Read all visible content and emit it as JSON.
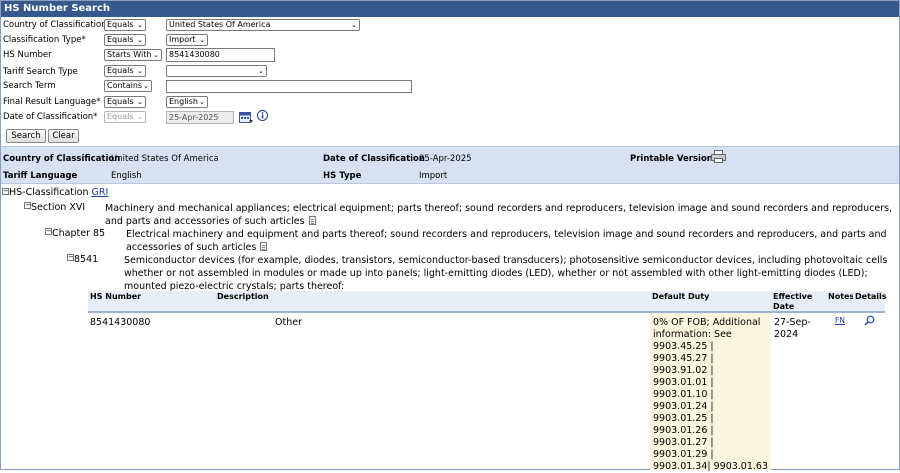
{
  "title": "HS Number Search",
  "form": {
    "country": {
      "label": "Country of Classification*",
      "op": "Equals",
      "value": "United States Of America"
    },
    "classification_type": {
      "label": "Classification Type*",
      "op": "Equals",
      "value": "Import"
    },
    "hs_number": {
      "label": "HS Number",
      "op": "Starts With",
      "value": "8541430080"
    },
    "tariff_search_type": {
      "label": "Tariff Search Type",
      "op": "Equals",
      "value": ""
    },
    "search_term": {
      "label": "Search Term",
      "op": "Contains",
      "value": ""
    },
    "final_result_language": {
      "label": "Final Result Language*",
      "op": "Equals",
      "value": "English"
    },
    "date_of_classification": {
      "label": "Date of Classification*",
      "op": "Equals",
      "value": "25-Apr-2025"
    },
    "search_button": "Search",
    "clear_button": "Clear"
  },
  "summary": {
    "country_label": "Country of Classification",
    "country_value": "United States Of America",
    "date_label": "Date of Classification",
    "date_value": "25-Apr-2025",
    "printable_label": "Printable Version",
    "tariff_language_label": "Tariff Language",
    "tariff_language_value": "English",
    "hs_type_label": "HS Type",
    "hs_type_value": "Import"
  },
  "tree": {
    "root_label": "HS-Classification",
    "root_link": "GRI",
    "section_label": "Section XVI",
    "section_desc": "Machinery and mechanical appliances; electrical equipment; parts thereof; sound recorders and reproducers, television image and sound recorders and reproducers, and parts and accessories of such articles",
    "chapter_label": "Chapter 85",
    "chapter_desc": "Electrical machinery and equipment and parts thereof; sound recorders and reproducers, television image and sound recorders and reproducers, and parts and accessories of such articles",
    "heading_label": "8541",
    "heading_desc": "Semiconductor devices (for example, diodes, transistors, semiconductor-based transducers); photosensitive semiconductor devices, including photovoltaic cells whether or not assembled in modules or made up into panels; light-emitting diodes (LED), whether or not assembled with other light-emitting diodes (LED); mounted piezo-electric crystals; parts thereof:"
  },
  "table": {
    "headers": [
      "HS Number",
      "Description",
      "Default Duty",
      "Effective Date",
      "Notes",
      "Details"
    ],
    "row": {
      "hs_number": "8541430080",
      "description": "Other",
      "duty_lines": [
        "0% OF FOB; Additional",
        "information: See",
        "9903.45.25 |",
        "9903.45.27 |",
        "9903.91.02 |",
        "9903.01.01 |",
        "9903.01.10 |",
        "9903.01.24 |",
        "9903.01.25 |",
        "9903.01.26 |",
        "9903.01.27 |",
        "9903.01.29 |",
        "9903.01.34| 9903.01.63"
      ],
      "effective_date": "27-Sep-2024",
      "notes_link": "FN"
    }
  },
  "colors": {
    "header_bg": "#36598d",
    "summary_bg": "#d6e2f2",
    "duty_bg": "#fbf5df",
    "link": "#1d3aa8"
  }
}
